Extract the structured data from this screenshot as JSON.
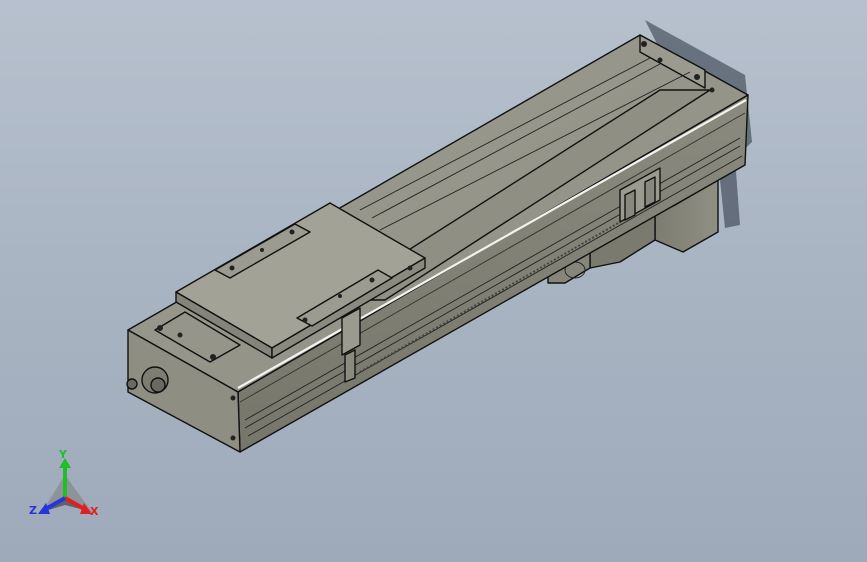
{
  "viewport": {
    "background_top": "#b7c1ce",
    "background_bottom": "#9eaaba"
  },
  "model": {
    "body_color": "#8d8d80",
    "top_color": "#9a9a8e",
    "side_color": "#7f7f73",
    "edge_color": "#111111",
    "highlight_color": "#f2f2ee"
  },
  "triad": {
    "x_label": "X",
    "y_label": "Y",
    "z_label": "Z",
    "x_color": "#e02020",
    "y_color": "#1fbf2a",
    "z_color": "#2436d8"
  }
}
